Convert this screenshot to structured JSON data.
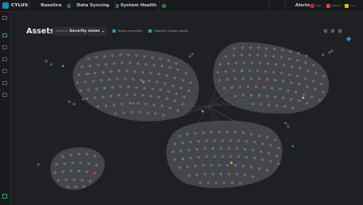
{
  "app": {
    "logo_text": "CYLUS",
    "nav": [
      {
        "label": "Baseline",
        "status_icon": "check-circle-icon",
        "status_color": "#29b45b"
      },
      {
        "label": "Data Syncing",
        "status_icon": "check-circle-icon",
        "status_color": "#29b45b"
      },
      {
        "label": "System Health",
        "status_icon": "check-circle-icon",
        "status_color": "#29b45b"
      }
    ],
    "alerts": {
      "label": "Alerts",
      "chips": [
        {
          "label": "High",
          "color": "#c8212b"
        },
        {
          "label": "Medium",
          "color": "#d6453a"
        },
        {
          "label": "Low",
          "color": "#e6b31c"
        }
      ]
    }
  },
  "page": {
    "title": "Assets",
    "groupby": {
      "label": "Group by",
      "value": "Security zones"
    },
    "toggles": [
      {
        "label": "Show connection",
        "checked": true
      },
      {
        "label": "Highlight chosen assets",
        "checked": true
      }
    ]
  },
  "colors": {
    "zone_fill": "#4b4d53",
    "node_stroke": "#9b9ea6",
    "node_blue": "#2c97d0",
    "node_red": "#c8212b",
    "node_orange": "#e07a2b",
    "node_yellow": "#d6c22e",
    "node_green": "#29b45b",
    "cursor": "#e01fd6"
  }
}
